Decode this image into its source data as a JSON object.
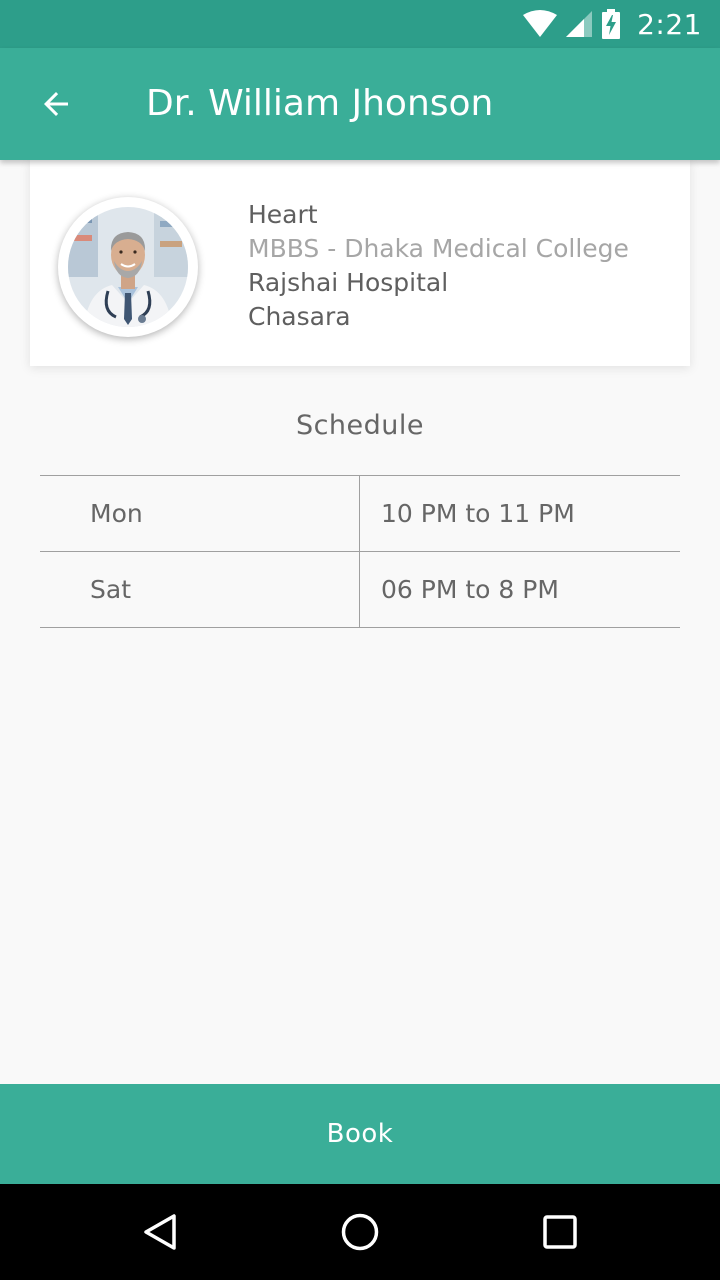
{
  "status_bar": {
    "time": "2:21",
    "icons": [
      "wifi-icon",
      "cell-signal-icon",
      "battery-charging-icon"
    ],
    "background": "#2d9e8a"
  },
  "app_bar": {
    "back_icon": "arrow-back-icon",
    "title": "Dr. William Jhonson",
    "background": "#3aae98"
  },
  "profile": {
    "avatar": "doctor-photo",
    "specialty": "Heart",
    "degree": "MBBS - Dhaka Medical College",
    "hospital": "Rajshai Hospital",
    "location": "Chasara"
  },
  "schedule": {
    "title": "Schedule",
    "rows": [
      {
        "day": "Mon",
        "time": "10 PM to 11 PM"
      },
      {
        "day": "Sat",
        "time": "06 PM to 8 PM"
      }
    ]
  },
  "book_button": {
    "label": "Book",
    "background": "#3aae98"
  },
  "nav_bar": {
    "icons": [
      "back-triangle-icon",
      "home-circle-icon",
      "recents-square-icon"
    ]
  }
}
